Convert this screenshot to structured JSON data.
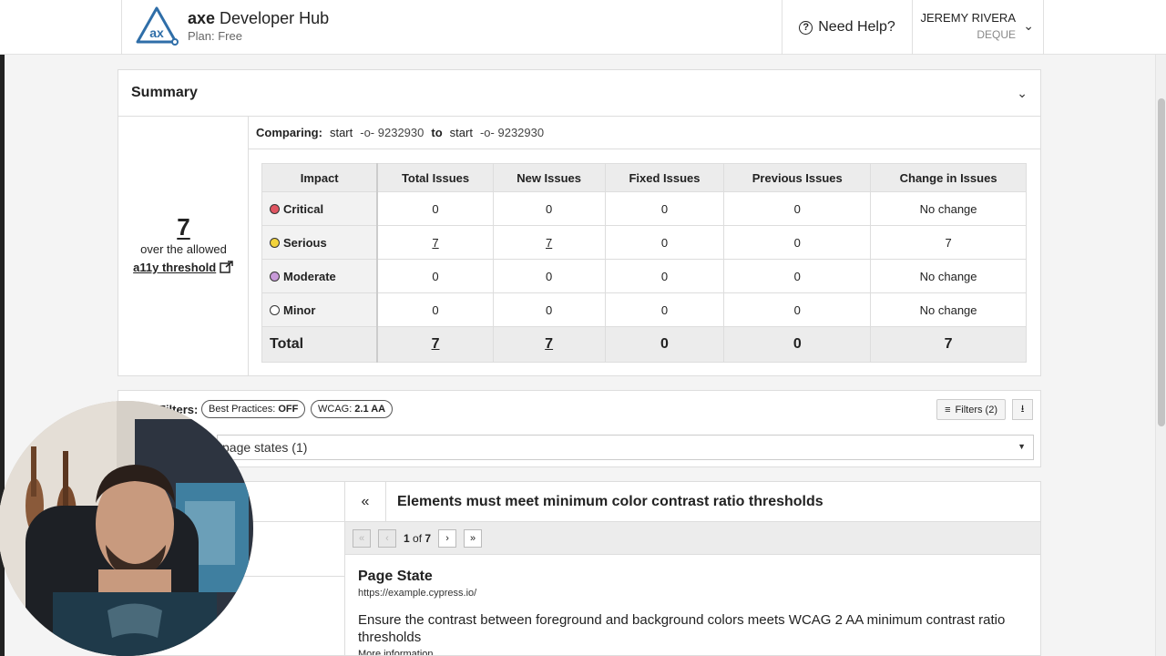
{
  "header": {
    "brand_bold": "axe",
    "brand_rest": " Developer Hub",
    "plan": "Plan: Free",
    "help": "Need Help?",
    "user_name": "JEREMY RIVERA",
    "user_org": "DEQUE"
  },
  "summary": {
    "title": "Summary",
    "threshold_number": "7",
    "threshold_text": "over the allowed",
    "threshold_link": "a11y threshold",
    "comparing_label": "Comparing:",
    "from_branch": "start",
    "from_commit": "9232930",
    "to_word": "to",
    "to_branch": "start",
    "to_commit": "9232930",
    "columns": [
      "Impact",
      "Total Issues",
      "New Issues",
      "Fixed Issues",
      "Previous Issues",
      "Change in Issues"
    ],
    "rows": [
      {
        "impact": "Critical",
        "color": "#e05561",
        "total": "0",
        "new": "0",
        "fixed": "0",
        "previous": "0",
        "change": "No change"
      },
      {
        "impact": "Serious",
        "color": "#f2d33c",
        "total": "7",
        "new": "7",
        "fixed": "0",
        "previous": "0",
        "change": "7"
      },
      {
        "impact": "Moderate",
        "color": "#c89ad9",
        "total": "0",
        "new": "0",
        "fixed": "0",
        "previous": "0",
        "change": "No change"
      },
      {
        "impact": "Minor",
        "color": "#ffffff",
        "total": "0",
        "new": "0",
        "fixed": "0",
        "previous": "0",
        "change": "No change"
      }
    ],
    "total_row": {
      "label": "Total",
      "total": "7",
      "new": "7",
      "fixed": "0",
      "previous": "0",
      "change": "7"
    }
  },
  "filters": {
    "label": "Filters:",
    "chip1_label": "Best Practices:",
    "chip1_value": "OFF",
    "chip2_label": "WCAG:",
    "chip2_value": "2.1 AA",
    "filters_button": "Filters (2)",
    "page_states": "page states (1)"
  },
  "issue": {
    "title": "Elements must meet minimum color contrast ratio thresholds",
    "pager_current": "1",
    "pager_of": "of",
    "pager_total": "7",
    "page_state_title": "Page State",
    "page_state_url": "https://example.cypress.io/",
    "description": "Ensure the contrast between foreground and background colors meets WCAG 2 AA minimum contrast ratio thresholds",
    "more_info": "More information"
  }
}
